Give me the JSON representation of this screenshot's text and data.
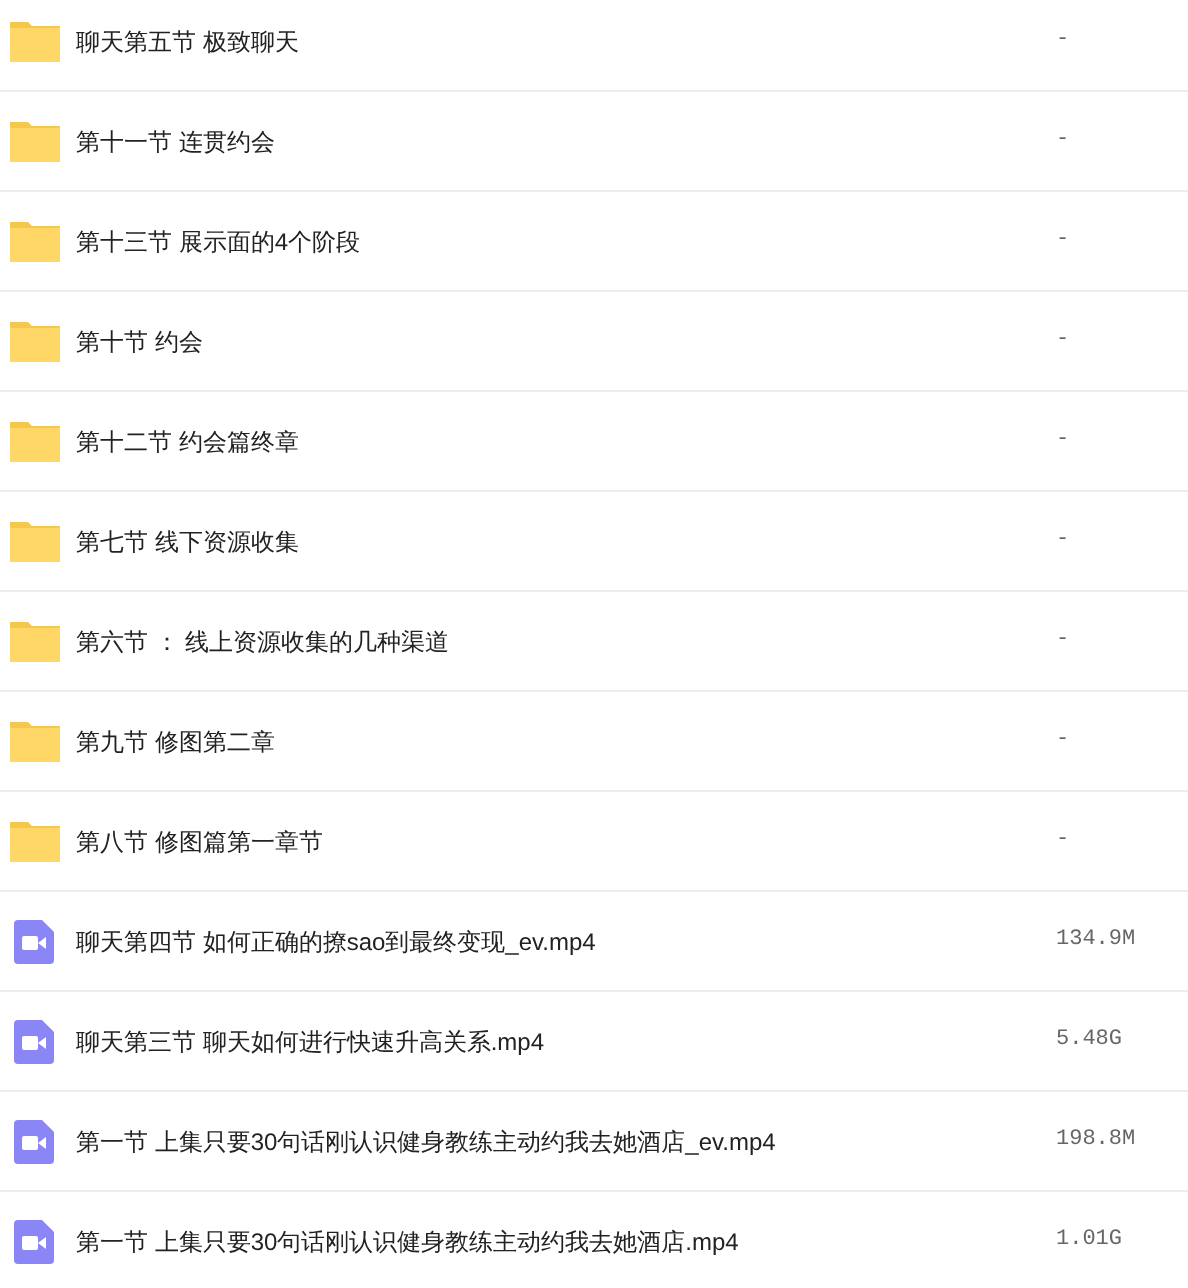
{
  "files": [
    {
      "kind": "folder",
      "name": "聊天第五节 极致聊天",
      "size": "-"
    },
    {
      "kind": "folder",
      "name": "第十一节 连贯约会",
      "size": "-"
    },
    {
      "kind": "folder",
      "name": "第十三节 展示面的4个阶段",
      "size": "-"
    },
    {
      "kind": "folder",
      "name": "第十节 约会",
      "size": "-"
    },
    {
      "kind": "folder",
      "name": "第十二节 约会篇终章",
      "size": "-"
    },
    {
      "kind": "folder",
      "name": "第七节 线下资源收集",
      "size": "-"
    },
    {
      "kind": "folder",
      "name": "第六节 ： 线上资源收集的几种渠道",
      "size": "-"
    },
    {
      "kind": "folder",
      "name": "第九节 修图第二章",
      "size": "-"
    },
    {
      "kind": "folder",
      "name": "第八节 修图篇第一章节",
      "size": "-"
    },
    {
      "kind": "video",
      "name": "聊天第四节 如何正确的撩sao到最终变现_ev.mp4",
      "size": "134.9M"
    },
    {
      "kind": "video",
      "name": "聊天第三节 聊天如何进行快速升高关系.mp4",
      "size": "5.48G"
    },
    {
      "kind": "video",
      "name": "第一节 上集只要30句话刚认识健身教练主动约我去她酒店_ev.mp4",
      "size": "198.8M"
    },
    {
      "kind": "video",
      "name": "第一节 上集只要30句话刚认识健身教练主动约我去她酒店.mp4",
      "size": "1.01G"
    }
  ]
}
